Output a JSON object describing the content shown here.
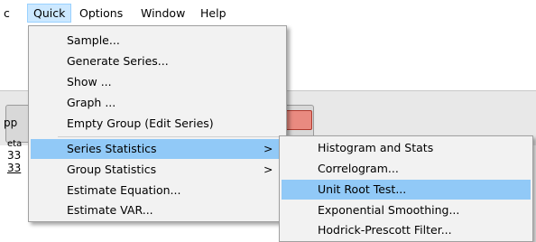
{
  "menubar": {
    "items": [
      "c",
      "Quick",
      "Options",
      "Window",
      "Help"
    ],
    "active": "Quick"
  },
  "background": {
    "fragments": [
      "pp",
      "eta",
      "33",
      "33"
    ]
  },
  "quick_menu": {
    "items": [
      {
        "label": "Sample...",
        "submenu": false
      },
      {
        "label": "Generate Series...",
        "submenu": false
      },
      {
        "label": "Show ...",
        "submenu": false
      },
      {
        "label": "Graph ...",
        "submenu": false
      },
      {
        "label": "Empty Group (Edit Series)",
        "submenu": false
      },
      {
        "label": "Series Statistics",
        "submenu": true,
        "highlighted": true
      },
      {
        "label": "Group Statistics",
        "submenu": true
      },
      {
        "label": "Estimate Equation...",
        "submenu": false
      },
      {
        "label": "Estimate VAR...",
        "submenu": false
      }
    ],
    "submenu_arrow": ">"
  },
  "series_statistics_menu": {
    "items": [
      {
        "label": "Histogram and Stats"
      },
      {
        "label": "Correlogram..."
      },
      {
        "label": "Unit Root Test...",
        "highlighted": true
      },
      {
        "label": "Exponential Smoothing..."
      },
      {
        "label": "Hodrick-Prescott Filter..."
      }
    ]
  },
  "colors": {
    "highlight": "#91c9f7",
    "menu_bar_active": "#cce8ff",
    "menu_background": "#f2f2f2"
  }
}
